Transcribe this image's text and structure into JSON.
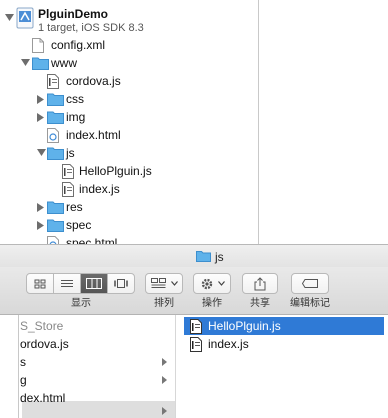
{
  "navigator": {
    "project": {
      "name": "PlguinDemo",
      "subtitle": "1 target, iOS SDK 8.3"
    },
    "items": [
      {
        "label": "config.xml"
      },
      {
        "label": "www"
      },
      {
        "label": "cordova.js"
      },
      {
        "label": "css"
      },
      {
        "label": "img"
      },
      {
        "label": "index.html"
      },
      {
        "label": "js"
      },
      {
        "label": "HelloPlguin.js"
      },
      {
        "label": "index.js"
      },
      {
        "label": "res"
      },
      {
        "label": "spec"
      },
      {
        "label": "spec.html"
      }
    ]
  },
  "finder": {
    "title": "js",
    "toolbar": {
      "view_label": "显示",
      "arrange_label": "排列",
      "action_label": "操作",
      "share_label": "共享",
      "tags_label": "编辑标记"
    },
    "column1": [
      {
        "label": "S_Store"
      },
      {
        "label": "ordova.js"
      },
      {
        "label": "s"
      },
      {
        "label": "g"
      },
      {
        "label": "dex.html"
      },
      {
        "label": ""
      }
    ],
    "column2": [
      {
        "label": "HelloPlguin.js",
        "selected": true
      },
      {
        "label": "index.js",
        "selected": false
      }
    ]
  },
  "colors": {
    "folder_blue": "#5fb2ea",
    "selection_blue": "#2f7ad6",
    "toolbar_gray": "#dcdcdc"
  }
}
